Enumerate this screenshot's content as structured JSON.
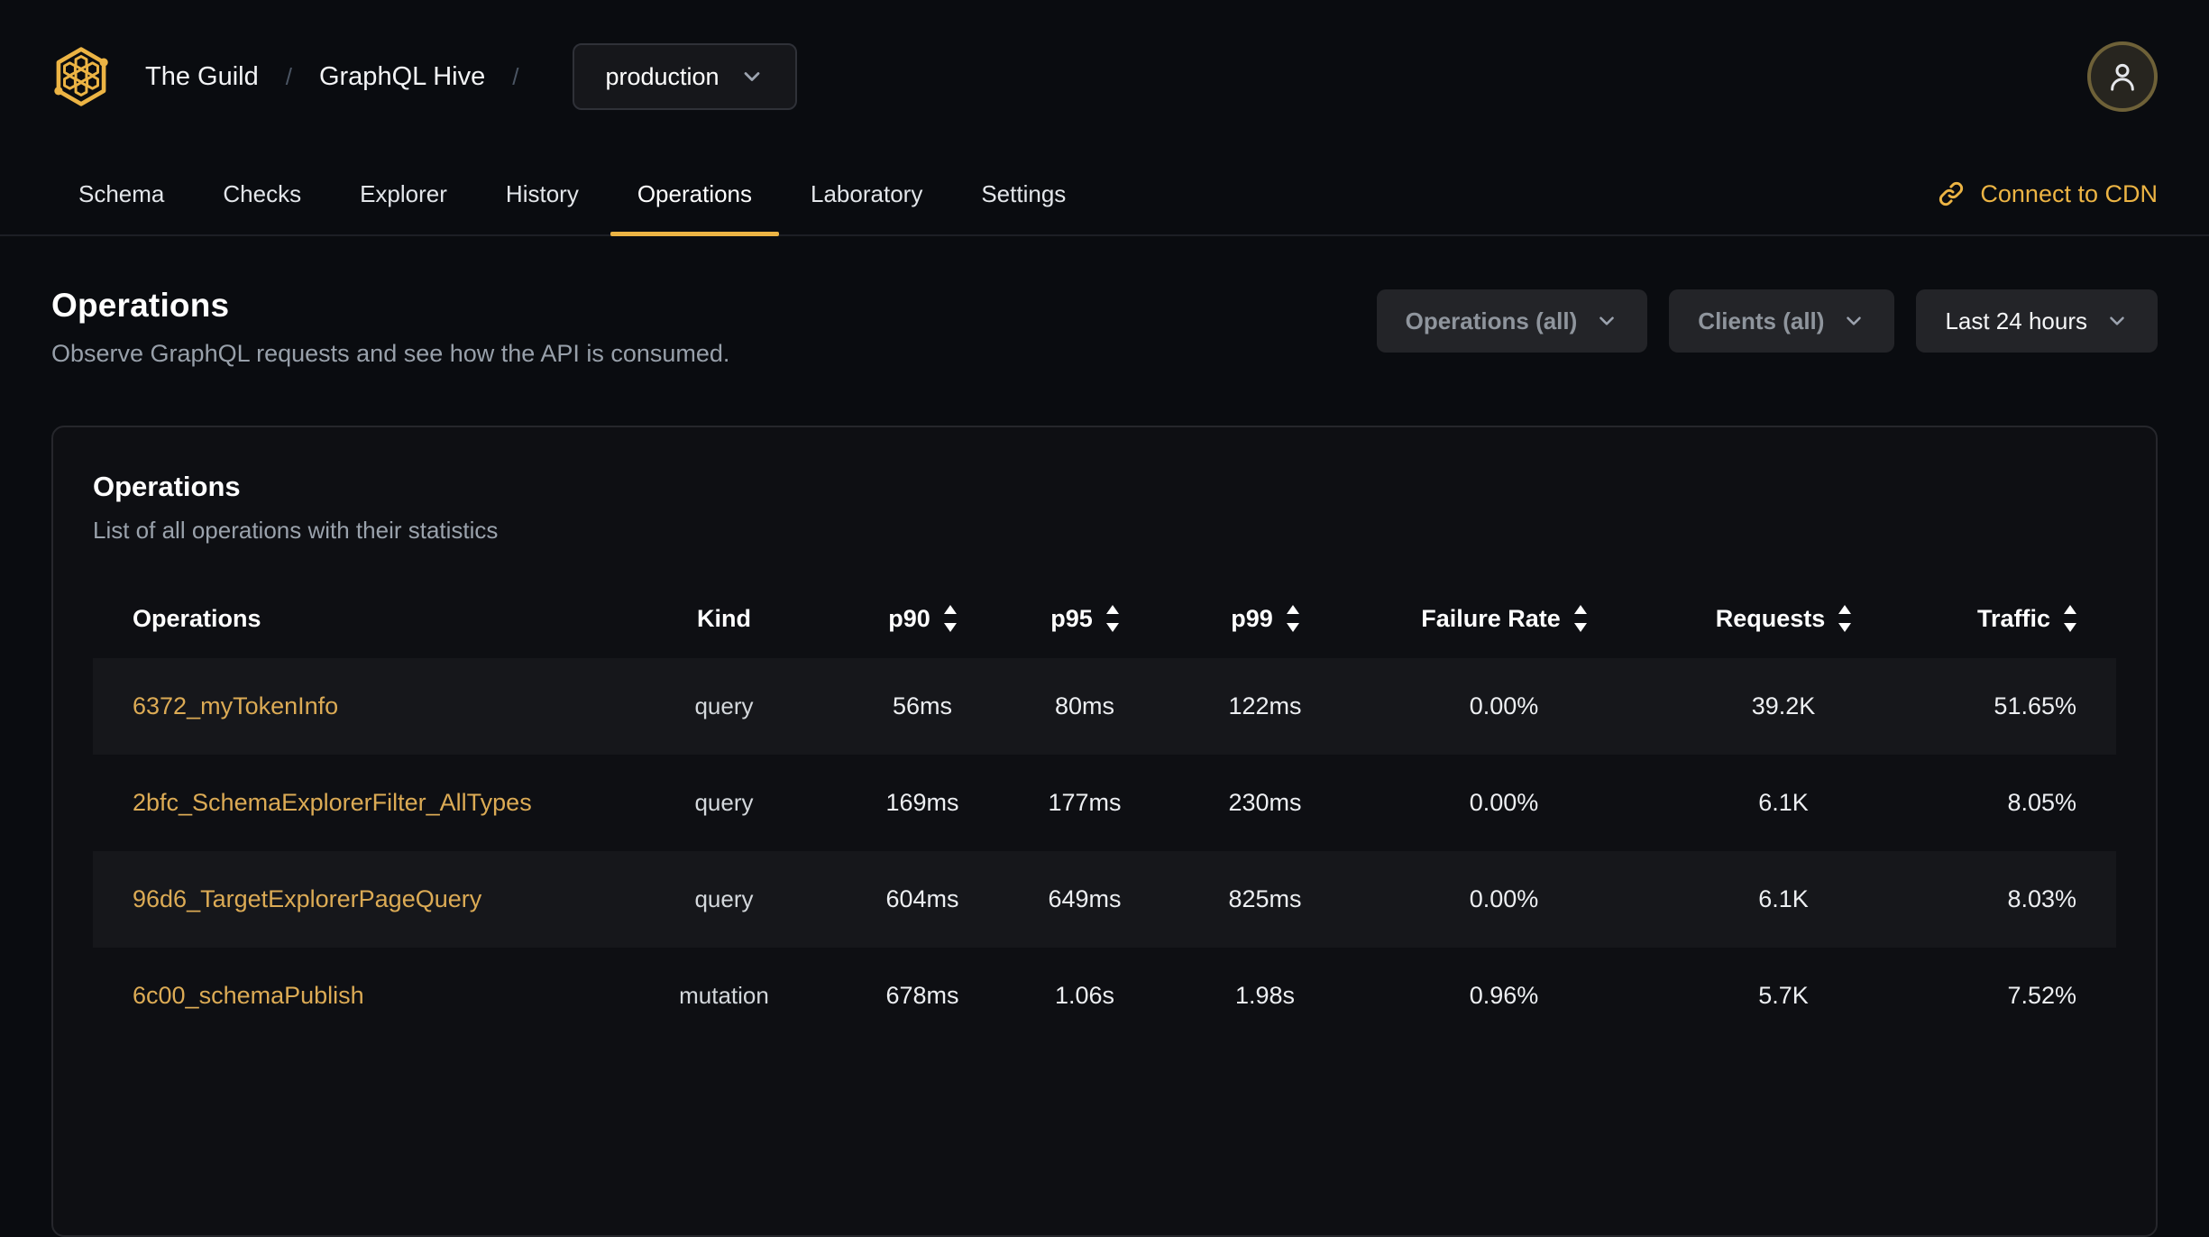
{
  "colors": {
    "accent": "#ecb444",
    "link": "#dcab55",
    "background": "#0a0c10",
    "card_border": "#26272c",
    "stripe": "#16171b"
  },
  "header": {
    "org": "The Guild",
    "separator": "/",
    "project": "GraphQL Hive",
    "target_selector": {
      "value": "production"
    },
    "logo_icon": "hive-honeycomb-logo",
    "avatar_icon": "user-icon"
  },
  "nav": {
    "tabs": [
      {
        "label": "Schema",
        "active": false
      },
      {
        "label": "Checks",
        "active": false
      },
      {
        "label": "Explorer",
        "active": false
      },
      {
        "label": "History",
        "active": false
      },
      {
        "label": "Operations",
        "active": true
      },
      {
        "label": "Laboratory",
        "active": false
      },
      {
        "label": "Settings",
        "active": false
      }
    ],
    "cdn_link": {
      "label": "Connect to CDN",
      "icon": "link-icon"
    }
  },
  "page": {
    "title": "Operations",
    "subtitle": "Observe GraphQL requests and see how the API is consumed."
  },
  "filters": [
    {
      "label": "Operations (all)",
      "enabled": false
    },
    {
      "label": "Clients (all)",
      "enabled": false
    },
    {
      "label": "Last 24 hours",
      "enabled": true
    }
  ],
  "card": {
    "title": "Operations",
    "subtitle": "List of all operations with their statistics"
  },
  "table": {
    "columns": [
      {
        "label": "Operations",
        "key": "name",
        "sortable": false,
        "align": "left"
      },
      {
        "label": "Kind",
        "key": "kind",
        "sortable": false,
        "align": "center"
      },
      {
        "label": "p90",
        "key": "p90",
        "sortable": true,
        "align": "center"
      },
      {
        "label": "p95",
        "key": "p95",
        "sortable": true,
        "align": "center"
      },
      {
        "label": "p99",
        "key": "p99",
        "sortable": true,
        "align": "center"
      },
      {
        "label": "Failure Rate",
        "key": "failure_rate",
        "sortable": true,
        "align": "center"
      },
      {
        "label": "Requests",
        "key": "requests",
        "sortable": true,
        "align": "center"
      },
      {
        "label": "Traffic",
        "key": "traffic",
        "sortable": true,
        "align": "right"
      }
    ],
    "rows": [
      {
        "name": "6372_myTokenInfo",
        "kind": "query",
        "p90": "56ms",
        "p95": "80ms",
        "p99": "122ms",
        "failure_rate": "0.00%",
        "requests": "39.2K",
        "traffic": "51.65%"
      },
      {
        "name": "2bfc_SchemaExplorerFilter_AllTypes",
        "kind": "query",
        "p90": "169ms",
        "p95": "177ms",
        "p99": "230ms",
        "failure_rate": "0.00%",
        "requests": "6.1K",
        "traffic": "8.05%"
      },
      {
        "name": "96d6_TargetExplorerPageQuery",
        "kind": "query",
        "p90": "604ms",
        "p95": "649ms",
        "p99": "825ms",
        "failure_rate": "0.00%",
        "requests": "6.1K",
        "traffic": "8.03%"
      },
      {
        "name": "6c00_schemaPublish",
        "kind": "mutation",
        "p90": "678ms",
        "p95": "1.06s",
        "p99": "1.98s",
        "failure_rate": "0.96%",
        "requests": "5.7K",
        "traffic": "7.52%"
      }
    ]
  }
}
